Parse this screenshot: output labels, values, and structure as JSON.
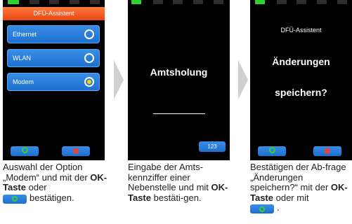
{
  "screen1": {
    "title": "DFÜ-Assistent",
    "options": [
      {
        "label": "Ethernet",
        "selected": false
      },
      {
        "label": "WLAN",
        "selected": false
      },
      {
        "label": "Modem",
        "selected": true
      }
    ]
  },
  "screen2": {
    "prompt": "Amtsholung",
    "key_label": "123"
  },
  "screen3": {
    "title": "DFÜ-Assistent",
    "line1": "Änderungen",
    "line2": "speichern?"
  },
  "captions": {
    "c1": {
      "part1": "Auswahl der Option „Modem“ und mit der ",
      "bold": "OK-Taste",
      "part2": " oder",
      "part3": "bestätigen."
    },
    "c2": {
      "part1": "Eingabe der Amts-kennziffer einer Nebenstelle und mit ",
      "bold": "OK-Taste",
      "part2": " bestäti-gen."
    },
    "c3": {
      "part1": "Bestätigen der Ab-frage „Änderungen speichern?“ mit der ",
      "bold": "OK-Taste",
      "part2": " oder mit",
      "part3": "."
    }
  },
  "colors": {
    "accent_blue": "#1c6fd0",
    "title_orange": "#e84712",
    "status_green": "#2ed12e",
    "cancel_red": "#ff3b30"
  }
}
